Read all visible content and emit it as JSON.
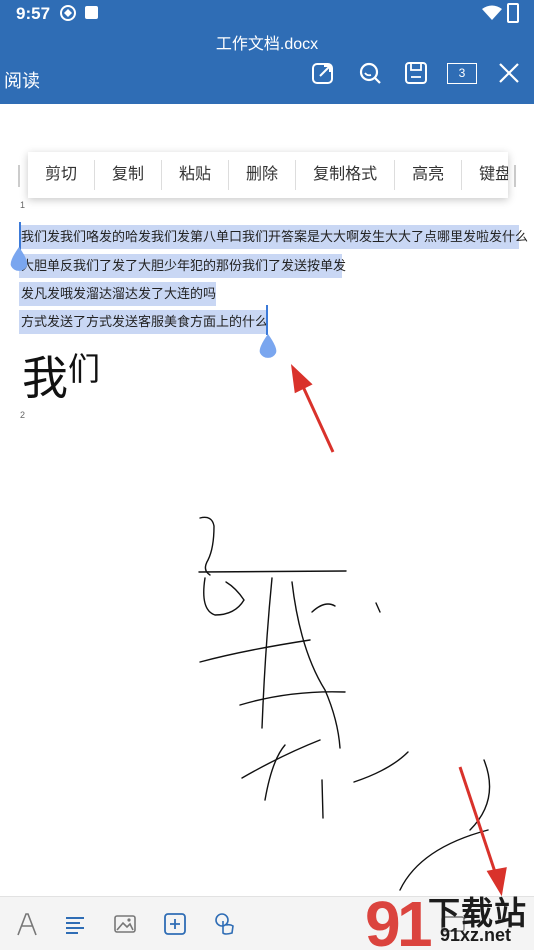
{
  "status": {
    "time": "9:57"
  },
  "titlebar": {
    "doc_title": "工作文档.docx",
    "mode_label": "阅读",
    "page_count": "3"
  },
  "context_menu": {
    "items": [
      "剪切",
      "复制",
      "粘贴",
      "删除",
      "复制格式",
      "高亮",
      "键盘"
    ]
  },
  "document": {
    "page1_number": "1",
    "page2_number": "2",
    "lines": [
      "我们发我们咯发的哈发我们发第八单口我们开答案是大大啊发生大大了点哪里发啦发什么",
      "大胆单反我们了发了大胆少年犯的那份我们了发送按单发",
      "发凡发哦发溜达溜达发了大连的吗",
      "方式发送了方式发送客服美食方面上的什么"
    ],
    "big_text_main": "我",
    "big_text_sup": "们"
  },
  "watermark": {
    "text": "下载站",
    "url": "91xz.net"
  },
  "colors": {
    "accent": "#2f6db5",
    "selection": "#c9d7f4",
    "handle": "#7aa6ef",
    "arrow": "#d9322b"
  }
}
